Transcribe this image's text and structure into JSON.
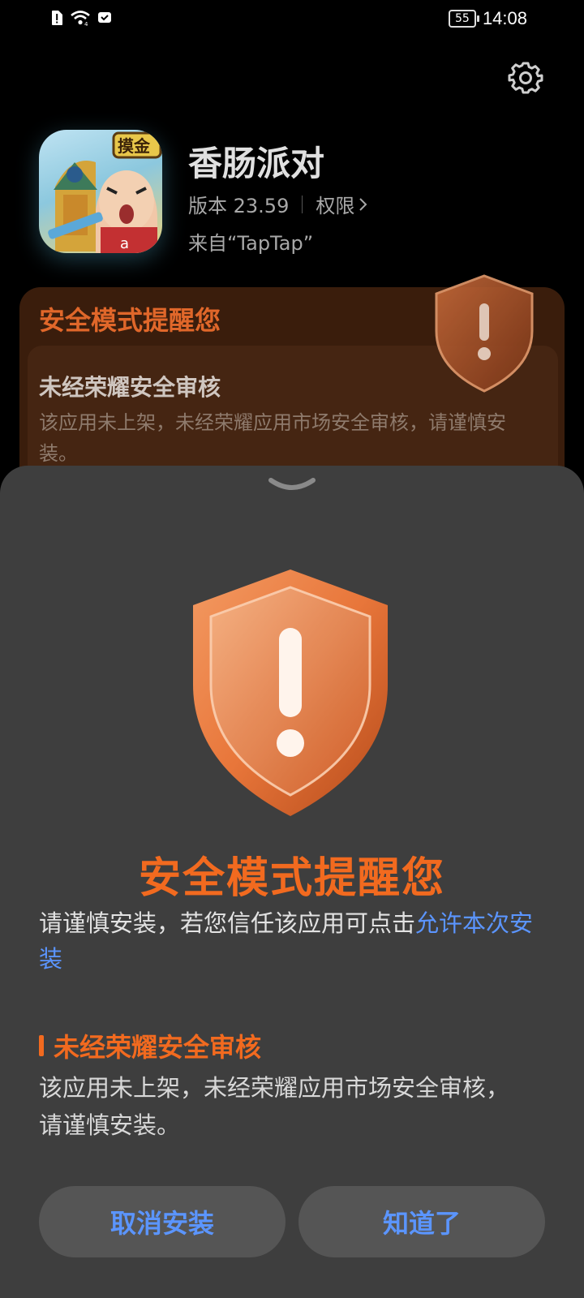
{
  "status_bar": {
    "battery": "55",
    "time": "14:08",
    "icons": [
      "sim-alert-icon",
      "wifi-icon",
      "message-icon"
    ]
  },
  "header": {
    "settings_icon": "gear-icon",
    "app_name": "香肠派对",
    "version": "版本 23.59",
    "permissions": "权限",
    "source": "来自“TapTap”",
    "icon_badge": "摸金"
  },
  "background_card": {
    "title": "安全模式提醒您",
    "subtitle": "未经荣耀安全审核",
    "text": "该应用未上架，未经荣耀应用市场安全审核，请谨慎安装。"
  },
  "sheet": {
    "title": "安全模式提醒您",
    "desc_prefix": "请谨慎安装，若您信任该应用可点击",
    "desc_link": "允许本次安装",
    "section_title": "未经荣耀安全审核",
    "section_text": "该应用未上架，未经荣耀应用市场安全审核，请谨慎安装。",
    "cancel_label": "取消安装",
    "ok_label": "知道了"
  },
  "colors": {
    "accent_orange": "#f26a1f",
    "link_blue": "#5b95ff",
    "sheet_bg": "#3e3e3e"
  }
}
